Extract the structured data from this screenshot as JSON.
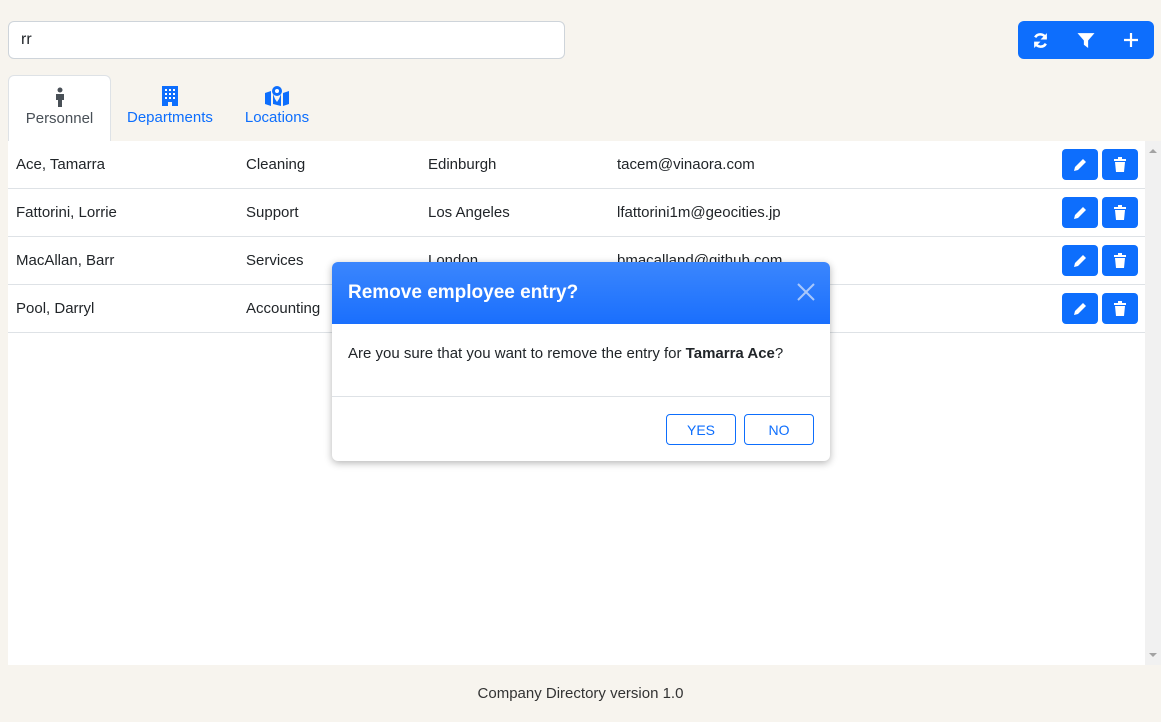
{
  "search": {
    "value": "rr"
  },
  "toolbar": {
    "refresh_icon": "refresh-icon",
    "filter_icon": "filter-icon",
    "add_icon": "plus-icon"
  },
  "tabs": [
    {
      "label": "Personnel",
      "icon": "person-icon",
      "active": true
    },
    {
      "label": "Departments",
      "icon": "building-icon"
    },
    {
      "label": "Locations",
      "icon": "map-location-icon"
    }
  ],
  "rows": [
    {
      "name": "Ace, Tamarra",
      "department": "Cleaning",
      "location": "Edinburgh",
      "email": "tacem@vinaora.com"
    },
    {
      "name": "Fattorini, Lorrie",
      "department": "Support",
      "location": "Los Angeles",
      "email": "lfattorini1m@geocities.jp"
    },
    {
      "name": "MacAllan, Barr",
      "department": "Services",
      "location": "London",
      "email": "bmacalland@github.com"
    },
    {
      "name": "Pool, Darryl",
      "department": "Accounting",
      "location": "",
      "email": ""
    }
  ],
  "modal": {
    "title": "Remove employee entry?",
    "message_prefix": "Are you sure that you want to remove the entry for ",
    "message_name": "Tamarra Ace",
    "message_suffix": "?",
    "yes": "YES",
    "no": "NO"
  },
  "footer": "Company Directory version 1.0",
  "colors": {
    "primary": "#0d6efd",
    "background": "#f7f4ee"
  }
}
